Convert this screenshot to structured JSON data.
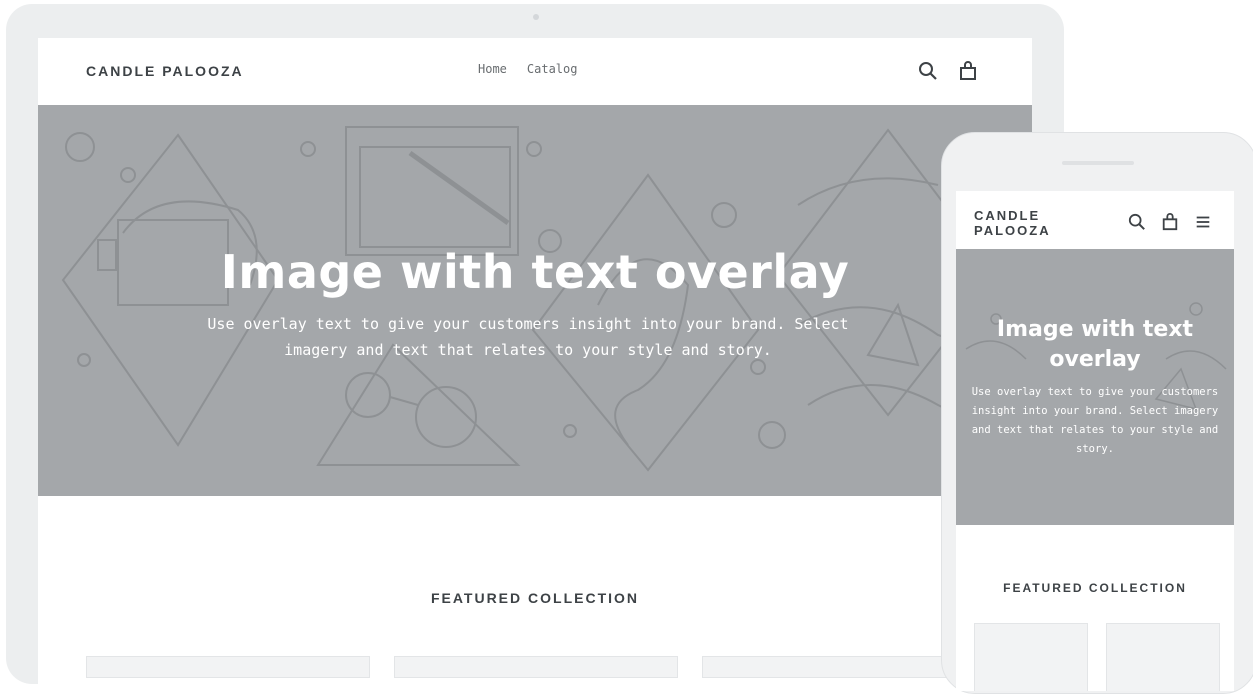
{
  "desktop": {
    "header": {
      "logo": "CANDLE PALOOZA",
      "nav": [
        "Home",
        "Catalog"
      ],
      "icons": [
        "search-icon",
        "cart-icon"
      ]
    },
    "hero": {
      "title": "Image with text overlay",
      "text": "Use overlay text to give your customers insight into your brand. Select imagery and text that relates to your style and story."
    },
    "featured_heading": "FEATURED COLLECTION"
  },
  "mobile": {
    "header": {
      "logo": "CANDLE PALOOZA",
      "icons": [
        "search-icon",
        "cart-icon",
        "menu-icon"
      ]
    },
    "hero": {
      "title": "Image with text overlay",
      "text": "Use overlay text to give your customers insight into your brand. Select imagery and text that relates to your style and story."
    },
    "featured_heading": "FEATURED COLLECTION"
  },
  "colors": {
    "hero_bg": "#a4a7aa",
    "text_dark": "#3d4246",
    "device_frame": "#eceeef"
  }
}
